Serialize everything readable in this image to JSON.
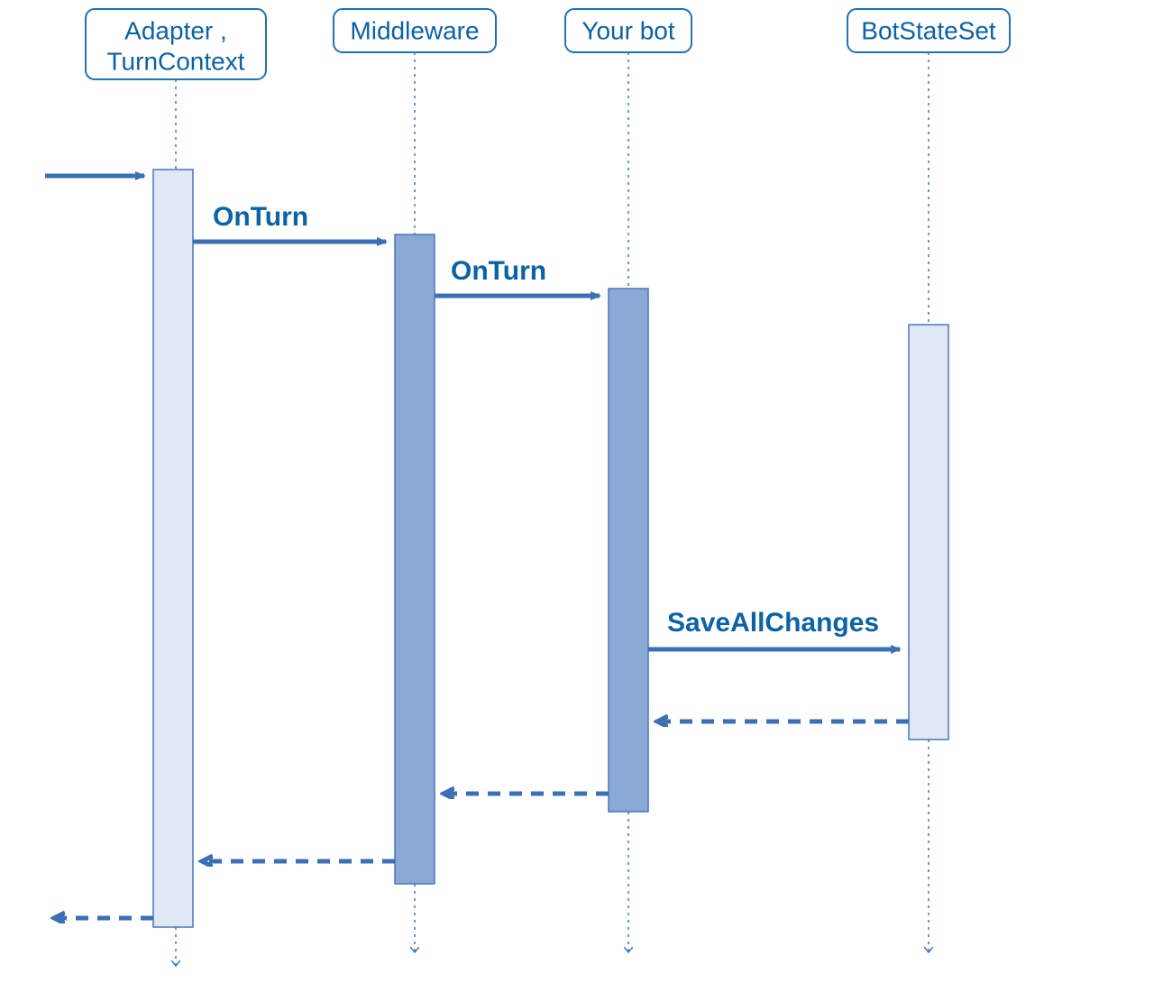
{
  "participants": {
    "adapter": {
      "label_line1": "Adapter ,",
      "label_line2": "TurnContext"
    },
    "middleware": {
      "label": "Middleware"
    },
    "yourbot": {
      "label": "Your bot"
    },
    "botstate": {
      "label": "BotStateSet"
    }
  },
  "messages": {
    "onturn1": "OnTurn",
    "onturn2": "OnTurn",
    "saveall": "SaveAllChanges"
  },
  "colors": {
    "accent": "#0a63a6",
    "line": "#3b6fb6",
    "boxborder": "#1f73b7"
  }
}
